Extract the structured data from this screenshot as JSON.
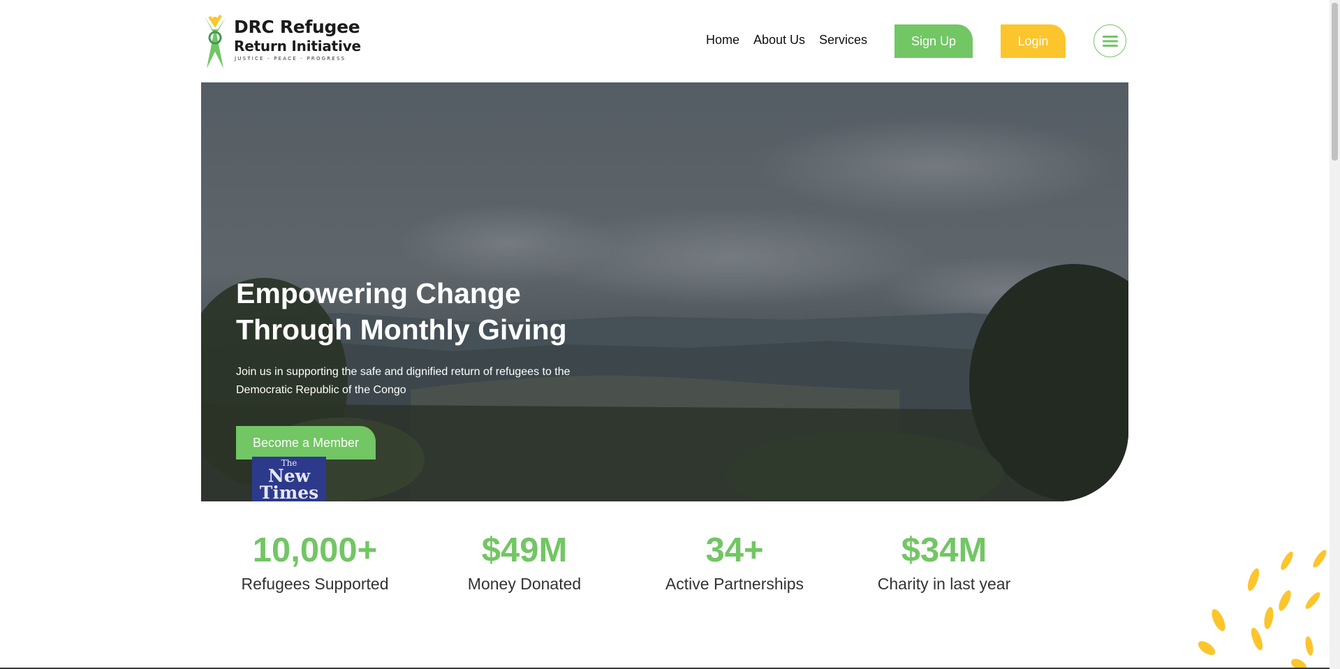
{
  "brand": {
    "title": "DRC Refugee",
    "subtitle": "Return Initiative",
    "tagline": "JUSTICE - PEACE - PROGRESS",
    "colors": {
      "green": "#72c664",
      "yellow": "#fcc52c"
    }
  },
  "nav": {
    "items": [
      {
        "label": "Home"
      },
      {
        "label": "About Us"
      },
      {
        "label": "Services"
      }
    ],
    "signup_label": "Sign Up",
    "login_label": "Login",
    "menu_icon": "hamburger-menu-icon"
  },
  "hero": {
    "title_line1": "Empowering Change",
    "title_line2": "Through Monthly Giving",
    "description": "Join us in supporting the safe and dignified return of refugees to the Democratic Republic of the Congo",
    "cta_label": "Become a Member",
    "newspaper_top": "The",
    "newspaper_name": "New Times"
  },
  "stats": [
    {
      "value": "10,000+",
      "label": "Refugees Supported"
    },
    {
      "value": "$49M",
      "label": "Money Donated"
    },
    {
      "value": "34+",
      "label": "Active Partnerships"
    },
    {
      "value": "$34M",
      "label": "Charity in last year"
    }
  ]
}
